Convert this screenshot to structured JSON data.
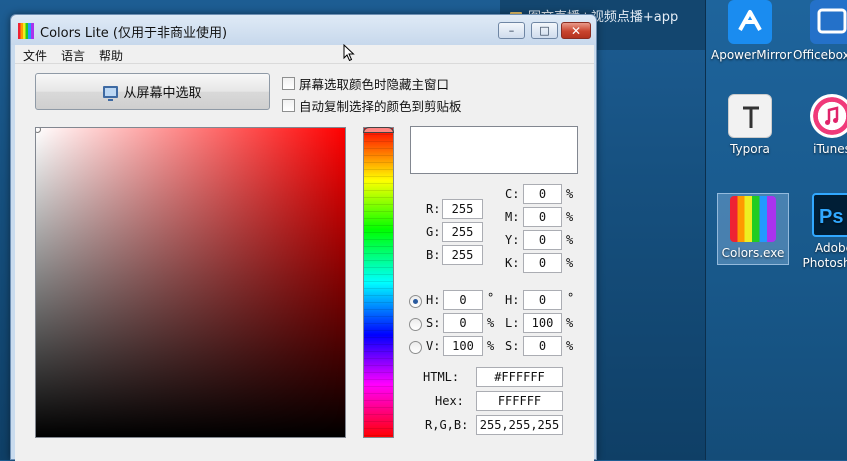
{
  "background": {
    "window_title": "图文直播+视频点播+app"
  },
  "desktop_icons": [
    {
      "label": "ApowerMirror",
      "icon": "apowermirror-icon"
    },
    {
      "label": "Officebox.exe",
      "icon": "officebox-icon"
    },
    {
      "label": "Typora",
      "icon": "typora-icon"
    },
    {
      "label": "iTunes",
      "icon": "itunes-icon"
    },
    {
      "label": "Colors.exe",
      "icon": "colors-exe-icon",
      "selected": true
    },
    {
      "label": "Adobe Photoshop",
      "icon": "photoshop-icon"
    }
  ],
  "window": {
    "title": "Colors Lite (仅用于非商业使用)",
    "controls": {
      "minimize": "–",
      "maximize": "□",
      "close": "✕"
    }
  },
  "menu": {
    "file": "文件",
    "language": "语言",
    "help": "帮助"
  },
  "toolbar": {
    "pick_button": "从屏幕中选取",
    "hide_window_checkbox": "屏幕选取颜色时隐藏主窗口",
    "copy_clipboard_checkbox": "自动复制选择的颜色到剪贴板"
  },
  "color": {
    "hex_swatch": "#FFFFFF",
    "rgb": {
      "r_label": "R:",
      "r": "255",
      "g_label": "G:",
      "g": "255",
      "b_label": "B:",
      "b": "255"
    },
    "cmyk": {
      "c_label": "C:",
      "c": "0",
      "m_label": "M:",
      "m": "0",
      "y_label": "Y:",
      "y": "0",
      "k_label": "K:",
      "k": "0",
      "unit": "%"
    },
    "hsv": {
      "h_label": "H:",
      "h": "0",
      "h_unit": "°",
      "s_label": "S:",
      "s": "0",
      "s_unit": "%",
      "v_label": "V:",
      "v": "100",
      "v_unit": "%"
    },
    "hsl": {
      "h_label": "H:",
      "h": "0",
      "h_unit": "°",
      "l_label": "L:",
      "l": "100",
      "l_unit": "%",
      "s_label": "S:",
      "s": "0",
      "s_unit": "%"
    },
    "mode_selected": "H",
    "html_label": "HTML:",
    "html": "#FFFFFF",
    "hex_label": "Hex:",
    "hex": "FFFFFF",
    "rgb_text_label": "R,G,B:",
    "rgb_text": "255,255,255"
  }
}
